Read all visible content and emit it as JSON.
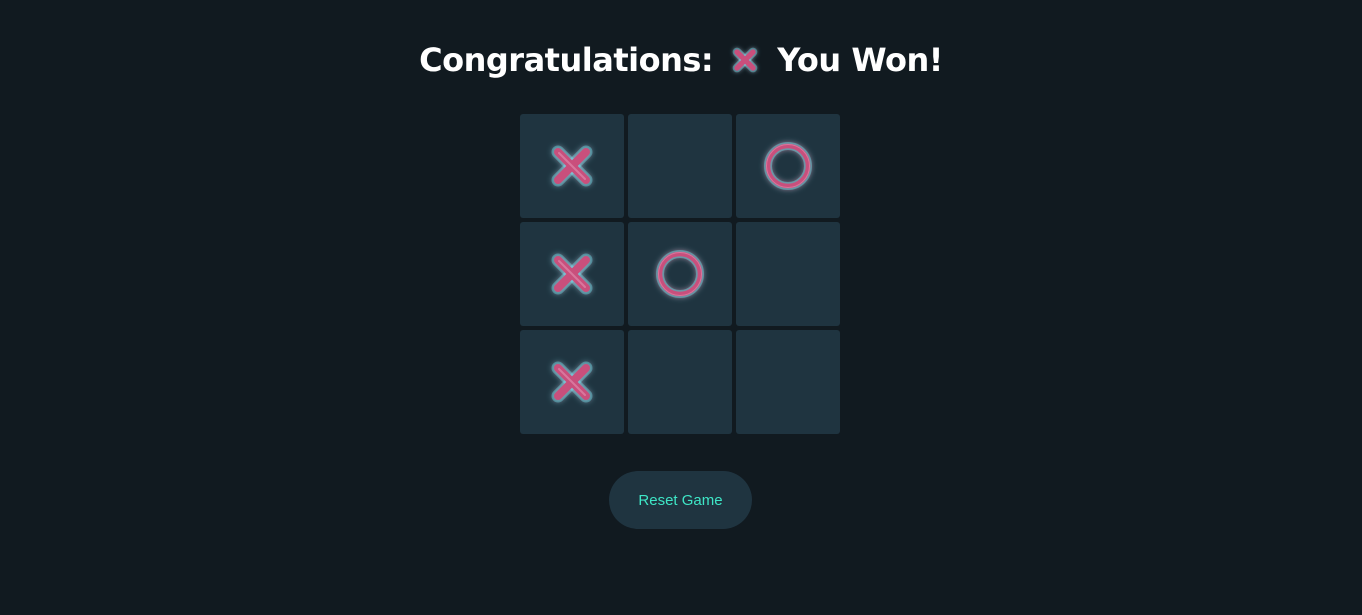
{
  "status": {
    "prefix": "Congratulations:",
    "winner": "X",
    "suffix": "You Won!"
  },
  "board": {
    "cells": [
      "X",
      "",
      "O",
      "X",
      "O",
      "",
      "X",
      "",
      ""
    ]
  },
  "reset_button": {
    "label": "Reset Game"
  },
  "colors": {
    "background": "#111a20",
    "cell": "#1f3440",
    "mark": "#c94f7c",
    "glow": "#5ff0ff",
    "button_text": "#3ee6c6"
  },
  "icons": {
    "x": "x-mark-icon",
    "o": "o-mark-icon"
  }
}
